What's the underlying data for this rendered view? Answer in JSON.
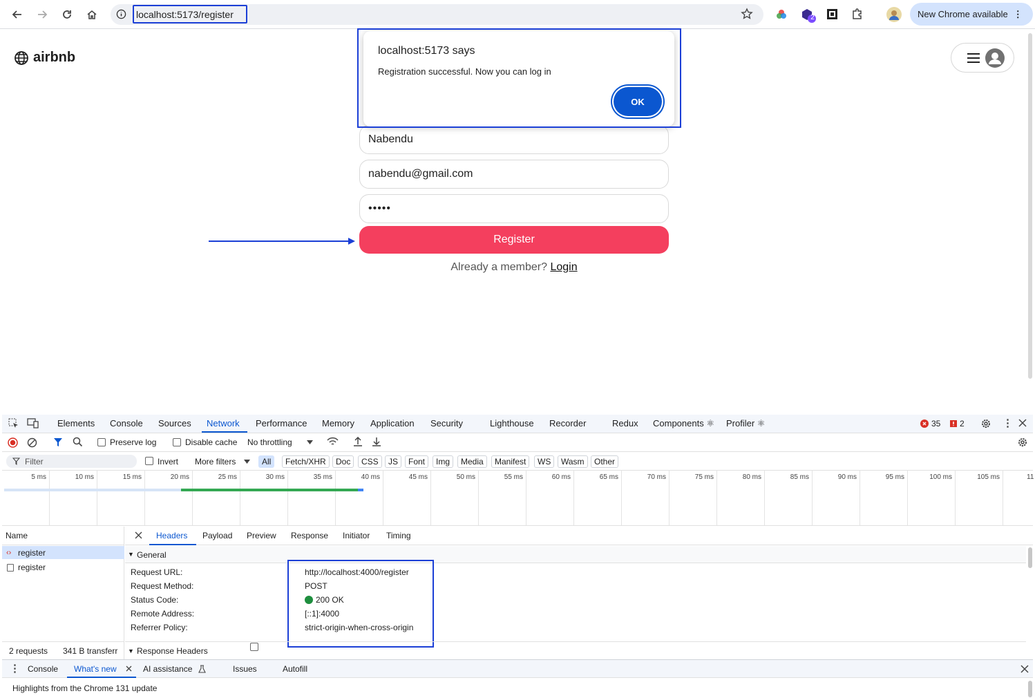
{
  "browser": {
    "url": "localhost:5173/register",
    "new_chrome": "New Chrome available",
    "ext_badge": "2"
  },
  "page": {
    "logo_text": "airbnb",
    "name_value": "Nabendu",
    "email_value": "nabendu@gmail.com",
    "password_value": "•••••",
    "register_label": "Register",
    "already_text": "Already a member?",
    "login_label": "Login"
  },
  "dialog": {
    "title": "localhost:5173 says",
    "message": "Registration successful. Now you can log in",
    "ok_label": "OK"
  },
  "devtools": {
    "tabs": [
      "Elements",
      "Console",
      "Sources",
      "Network",
      "Performance",
      "Memory",
      "Application",
      "Security",
      "Lighthouse",
      "Recorder",
      "Redux",
      "Components ⚛",
      "Profiler ⚛"
    ],
    "error_count": "35",
    "warning_count": "2",
    "preserve_log": "Preserve log",
    "disable_cache": "Disable cache",
    "throttling": "No throttling",
    "filter_placeholder": "Filter",
    "invert": "Invert",
    "more_filters": "More filters",
    "type_filters": [
      "All",
      "Fetch/XHR",
      "Doc",
      "CSS",
      "JS",
      "Font",
      "Img",
      "Media",
      "Manifest",
      "WS",
      "Wasm",
      "Other"
    ],
    "timeline_ticks": [
      "5 ms",
      "10 ms",
      "15 ms",
      "20 ms",
      "25 ms",
      "30 ms",
      "35 ms",
      "40 ms",
      "45 ms",
      "50 ms",
      "55 ms",
      "60 ms",
      "65 ms",
      "70 ms",
      "75 ms",
      "80 ms",
      "85 ms",
      "90 ms",
      "95 ms",
      "100 ms",
      "105 ms",
      "11"
    ],
    "name_header": "Name",
    "requests": [
      "register",
      "register"
    ],
    "detail_tabs": [
      "Headers",
      "Payload",
      "Preview",
      "Response",
      "Initiator",
      "Timing"
    ],
    "general_label": "General",
    "general_rows": [
      {
        "key": "Request URL:",
        "value": "http://localhost:4000/register"
      },
      {
        "key": "Request Method:",
        "value": "POST"
      },
      {
        "key": "Status Code:",
        "value": "200 OK"
      },
      {
        "key": "Remote Address:",
        "value": "[::1]:4000"
      },
      {
        "key": "Referrer Policy:",
        "value": "strict-origin-when-cross-origin"
      }
    ],
    "summary_requests": "2 requests",
    "summary_transferred": "341 B transferr",
    "response_headers": "Response Headers",
    "drawer_tabs": [
      "Console",
      "What's new",
      "AI assistance",
      "Issues",
      "Autofill"
    ],
    "drawer_text": "Highlights from the Chrome 131 update"
  },
  "colors": {
    "accent": "#f43f5e",
    "highlight": "#1b3fd6",
    "chrome_blue": "#0b57d0"
  }
}
